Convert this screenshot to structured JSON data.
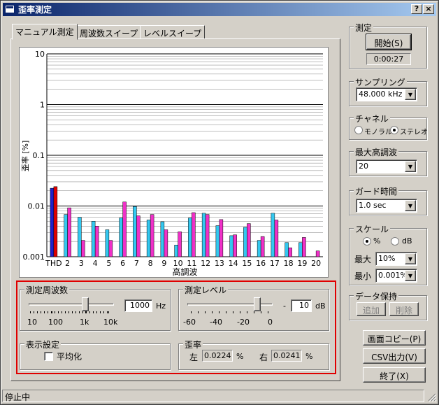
{
  "window": {
    "title": "歪率測定"
  },
  "titlebar": {
    "help": "?",
    "close": "×"
  },
  "tabs": [
    "マニュアル測定",
    "周波数スイープ",
    "レベルスイープ"
  ],
  "chart_data": {
    "type": "bar",
    "xlabel": "高調波",
    "ylabel": "歪率 [%]",
    "log_y": true,
    "ylim": [
      0.001,
      10
    ],
    "yticks": [
      "10",
      "1",
      "0.1",
      "0.01",
      "0.001"
    ],
    "categories": [
      "THD",
      "2",
      "3",
      "4",
      "5",
      "6",
      "7",
      "8",
      "9",
      "10",
      "11",
      "12",
      "13",
      "14",
      "15",
      "16",
      "17",
      "18",
      "19",
      "20"
    ],
    "series": [
      {
        "name": "左",
        "color": "#33c8f0",
        "values": [
          0.0224,
          0.0068,
          0.006,
          0.005,
          0.0034,
          0.0058,
          0.0098,
          0.0053,
          0.0049,
          0.0017,
          0.0058,
          0.0072,
          0.0041,
          0.0026,
          0.0038,
          0.0021,
          0.0072,
          0.0019,
          0.0019,
          0.001
        ]
      },
      {
        "name": "右",
        "color": "#f030c8",
        "values": [
          0.0241,
          0.0092,
          0.0021,
          0.004,
          0.0021,
          0.012,
          0.0064,
          0.0068,
          0.0034,
          0.0031,
          0.0074,
          0.0068,
          0.0054,
          0.0027,
          0.0045,
          0.0025,
          0.0053,
          0.0015,
          0.0024,
          0.0013
        ]
      }
    ],
    "grid": true,
    "thd_colors": {
      "left": "#2020c8",
      "right": "#e00000"
    }
  },
  "freq": {
    "label": "測定周波数",
    "value": "1000",
    "unit": "Hz",
    "scale": [
      "10",
      "100",
      "1k",
      "10k"
    ]
  },
  "level": {
    "label": "測定レベル",
    "sign": "-",
    "value": "10",
    "unit": "dB",
    "scale": [
      "-60",
      "-40",
      "-20",
      "0"
    ]
  },
  "display": {
    "label": "表示設定",
    "average": "平均化"
  },
  "distortion": {
    "label": "歪率",
    "left_label": "左",
    "left_value": "0.0224",
    "right_label": "右",
    "right_value": "0.0241",
    "unit": "%"
  },
  "measure": {
    "label": "測定",
    "start": "開始(S)",
    "time": "0:00:27"
  },
  "sampling": {
    "label": "サンプリング",
    "value": "48.000 kHz"
  },
  "channel": {
    "label": "チャネル",
    "mono": "モノラル",
    "stereo": "ステレオ"
  },
  "maxharm": {
    "label": "最大高調波",
    "value": "20"
  },
  "guard": {
    "label": "ガード時間",
    "value": "1.0 sec"
  },
  "scale": {
    "label": "スケール",
    "pct": "%",
    "db": "dB",
    "max_label": "最大",
    "max_value": "10%",
    "min_label": "最小",
    "min_value": "0.001%"
  },
  "hold": {
    "label": "データ保持",
    "add": "追加",
    "delete": "削除"
  },
  "buttons": {
    "copy": "画面コピー(P)",
    "csv": "CSV出力(V)",
    "exit": "終了(X)"
  },
  "status": {
    "text": "停止中"
  },
  "colors": {
    "highlight": "#e00000"
  }
}
